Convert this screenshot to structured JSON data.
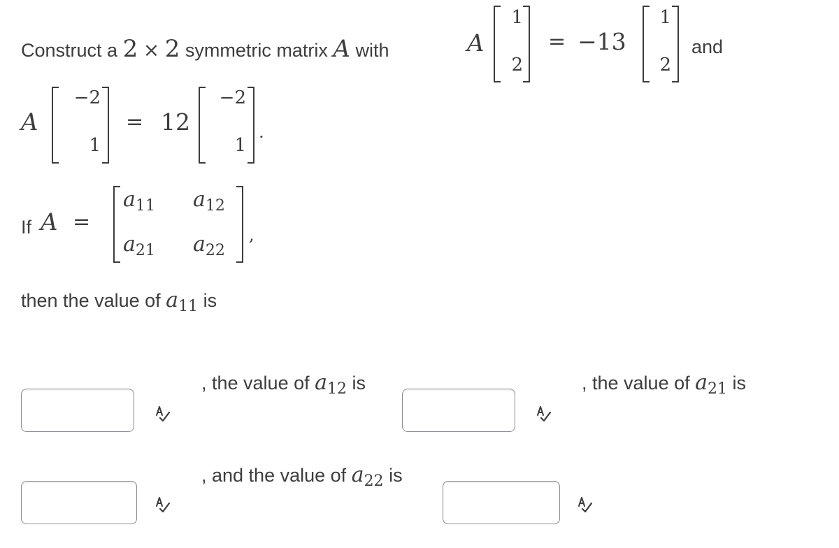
{
  "problem": {
    "line1": {
      "prefix": "Construct a",
      "dim1": "2",
      "times": "×",
      "dim2": "2",
      "middle": "symmetric matrix",
      "matrix_var": "A",
      "with": "with",
      "eq_lhs_var": "A",
      "vector1": [
        "1",
        "2"
      ],
      "equals": "=",
      "eigenvalue1": "−13",
      "vector1_rhs": [
        "1",
        "2"
      ],
      "and": "and"
    },
    "line2": {
      "lhs_var": "A",
      "vector2": [
        "−2",
        "1"
      ],
      "equals": "=",
      "eigenvalue2": "12",
      "vector2_rhs": [
        "−2",
        "1"
      ],
      "period": "."
    },
    "matrix_def": {
      "prefix": "If",
      "var": "A",
      "equals": "=",
      "entries": [
        {
          "base": "a",
          "sub": "11"
        },
        {
          "base": "a",
          "sub": "12"
        },
        {
          "base": "a",
          "sub": "21"
        },
        {
          "base": "a",
          "sub": "22"
        }
      ],
      "comma": ","
    },
    "prompt_a11": {
      "text": "then the value of",
      "base": "a",
      "sub": "11",
      "suffix": "is"
    },
    "prompt_a12": {
      "text": ", the value of",
      "base": "a",
      "sub": "12",
      "suffix": "is"
    },
    "prompt_a21": {
      "text": ", the value of",
      "base": "a",
      "sub": "21",
      "suffix": "is"
    },
    "prompt_a22": {
      "text": ", and the value of",
      "base": "a",
      "sub": "22",
      "suffix": "is"
    }
  },
  "answers": {
    "a11": {
      "value": "",
      "placeholder": ""
    },
    "a12": {
      "value": "",
      "placeholder": ""
    },
    "a21": {
      "value": "",
      "placeholder": ""
    },
    "a22": {
      "value": "",
      "placeholder": ""
    }
  },
  "icons": {
    "spell_check": "spell-check-icon"
  },
  "colors": {
    "text": "#3d3d3d",
    "input_border": "#8a8d90",
    "background": "#ffffff"
  }
}
